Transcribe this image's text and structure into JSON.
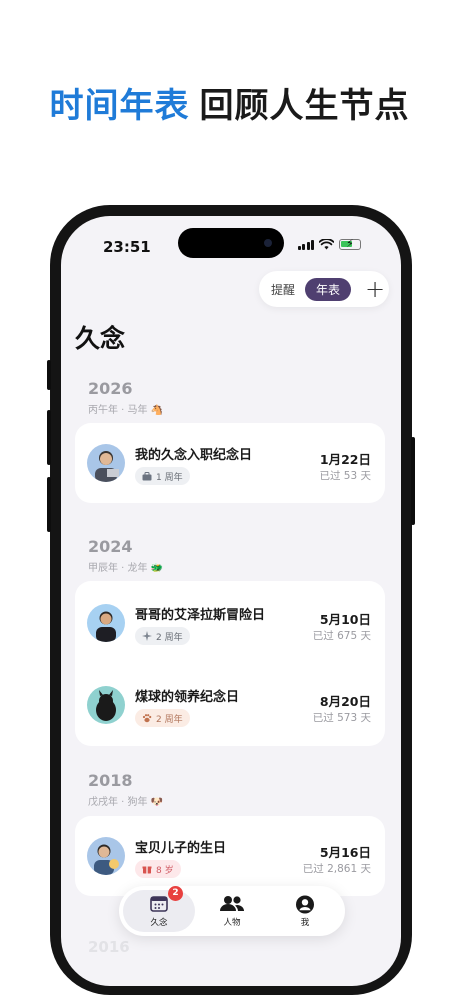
{
  "headline": {
    "accent": "时间年表",
    "rest": "回顾人生节点"
  },
  "status_bar": {
    "time": "23:51"
  },
  "top_pill": {
    "reminder": "提醒",
    "timeline": "年表",
    "add": "+"
  },
  "page_title": "久念",
  "sections": [
    {
      "year": "2026",
      "subtitle": "丙午年 · 马年 🐴"
    },
    {
      "year": "2024",
      "subtitle": "甲辰年 · 龙年 🐲"
    },
    {
      "year": "2018",
      "subtitle": "戊戌年 · 狗年 🐶"
    }
  ],
  "events": [
    {
      "title": "我的久念入职纪念日",
      "tag_icon": "briefcase-icon",
      "tag": "1 周年",
      "date": "1月22日",
      "ago": "已过 53 天"
    },
    {
      "title": "哥哥的艾泽拉斯冒险日",
      "tag_icon": "sparkle-icon",
      "tag": "2 周年",
      "date": "5月10日",
      "ago": "已过 675 天"
    },
    {
      "title": "煤球的领养纪念日",
      "tag_icon": "paw-icon",
      "tag": "2 周年",
      "date": "8月20日",
      "ago": "已过 573 天"
    },
    {
      "title": "宝贝儿子的生日",
      "tag_icon": "gift-icon",
      "tag": "8 岁",
      "date": "5月16日",
      "ago": "已过 2,861 天"
    }
  ],
  "faded_year": "2016",
  "tabbar": {
    "tabs": [
      {
        "label": "久念",
        "icon": "calendar-icon",
        "badge": "2"
      },
      {
        "label": "人物",
        "icon": "people-icon"
      },
      {
        "label": "我",
        "icon": "profile-icon"
      }
    ]
  },
  "colors": {
    "accent_blue": "#1f7bd8",
    "pill_purple": "#4f3f70",
    "badge_red": "#e8403f",
    "battery_green": "#3bc45a"
  }
}
